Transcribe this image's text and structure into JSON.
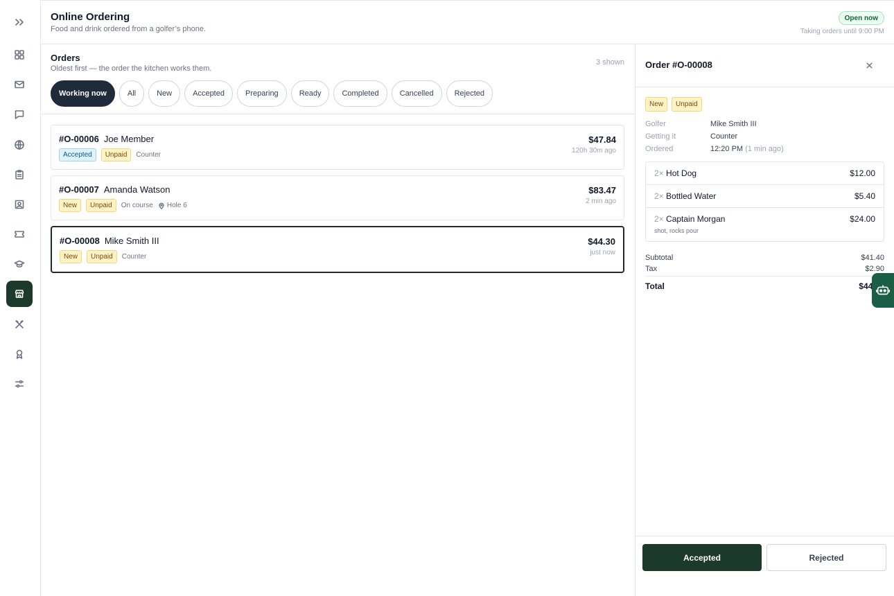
{
  "header": {
    "title": "Online Ordering",
    "subtitle": "Food and drink ordered from a golfer’s phone.",
    "status_badge": "Open now",
    "status_note": "Taking orders until 9:00 PM"
  },
  "sidebar": {
    "items": [
      {
        "icon": "expand-icon"
      },
      {
        "icon": "dashboard-icon"
      },
      {
        "icon": "mail-icon"
      },
      {
        "icon": "chat-icon"
      },
      {
        "icon": "globe-icon"
      },
      {
        "icon": "clipboard-icon"
      },
      {
        "icon": "contact-card-icon"
      },
      {
        "icon": "ticket-icon"
      },
      {
        "icon": "graduation-cap-icon"
      },
      {
        "icon": "store-icon",
        "active": true
      },
      {
        "icon": "utensils-icon"
      },
      {
        "icon": "award-icon"
      },
      {
        "icon": "sliders-icon"
      }
    ]
  },
  "orders": {
    "title": "Orders",
    "subtitle": "Oldest first — the order the kitchen works them.",
    "shown_count": "3 shown",
    "filters": [
      "Working now",
      "All",
      "New",
      "Accepted",
      "Preparing",
      "Ready",
      "Completed",
      "Cancelled",
      "Rejected"
    ],
    "active_filter": "Working now",
    "list": [
      {
        "number": "#O-00006",
        "name": "Joe Member",
        "status": "Accepted",
        "payment": "Unpaid",
        "pickup": "Counter",
        "location": "",
        "total": "$47.84",
        "age": "120h 30m ago"
      },
      {
        "number": "#O-00007",
        "name": "Amanda Watson",
        "status": "New",
        "payment": "Unpaid",
        "pickup": "On course",
        "location": "Hole 6",
        "total": "$83.47",
        "age": "2 min ago"
      },
      {
        "number": "#O-00008",
        "name": "Mike Smith III",
        "status": "New",
        "payment": "Unpaid",
        "pickup": "Counter",
        "location": "",
        "total": "$44.30",
        "age": "just now",
        "selected": true
      }
    ]
  },
  "detail": {
    "title": "Order #O-00008",
    "status": "New",
    "payment": "Unpaid",
    "golfer_label": "Golfer",
    "golfer": "Mike Smith III",
    "getting_label": "Getting it",
    "getting": "Counter",
    "ordered_label": "Ordered",
    "ordered_time": "12:20 PM",
    "ordered_ago": "(1 min ago)",
    "items": [
      {
        "qty": "2×",
        "name": "Hot Dog",
        "price": "$12.00",
        "note": ""
      },
      {
        "qty": "2×",
        "name": "Bottled Water",
        "price": "$5.40",
        "note": ""
      },
      {
        "qty": "2×",
        "name": "Captain Morgan",
        "price": "$24.00",
        "note": "shot, rocks pour"
      }
    ],
    "subtotal_label": "Subtotal",
    "subtotal": "$41.40",
    "tax_label": "Tax",
    "tax": "$2.90",
    "total_label": "Total",
    "total": "$44.30",
    "accept_label": "Accepted",
    "reject_label": "Rejected"
  }
}
